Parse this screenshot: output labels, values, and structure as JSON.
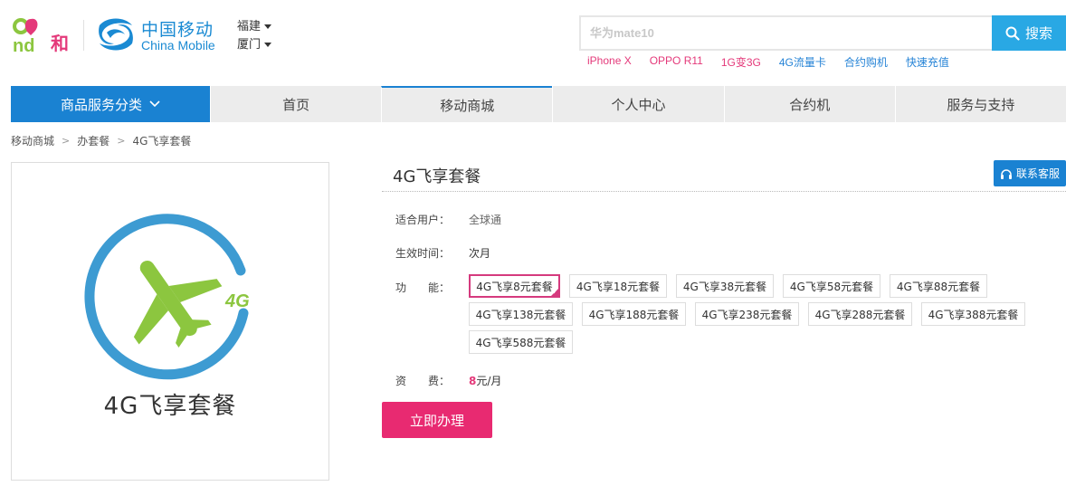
{
  "brand": {
    "and_logo": "and和",
    "cm_cn": "中国移动",
    "cm_en": "China Mobile"
  },
  "region": {
    "province": "福建",
    "city": "厦门"
  },
  "search": {
    "placeholder": "华为mate10",
    "button_label": "搜索",
    "hot_words": [
      "iPhone X",
      "OPPO R11",
      "1G变3G",
      "4G流量卡",
      "合约购机",
      "快速充值"
    ]
  },
  "nav": {
    "category_label": "商品服务分类",
    "items": [
      "首页",
      "移动商城",
      "个人中心",
      "合约机",
      "服务与支持"
    ],
    "active_index": 1
  },
  "breadcrumb": [
    "移动商城",
    "办套餐",
    "4G飞享套餐"
  ],
  "product": {
    "image_caption": "4G飞享套餐",
    "image_badge": "4G",
    "title": "4G飞享套餐",
    "service_button": "联系客服",
    "rows": {
      "user_label": "适合用户：",
      "user_value": "全球通",
      "effect_label": "生效时间：",
      "effect_value": "次月",
      "func_label": "功　　能：",
      "fee_label": "资　　费：",
      "fee_amount": "8",
      "fee_unit": "元/月"
    },
    "options": [
      "4G飞享8元套餐",
      "4G飞享18元套餐",
      "4G飞享38元套餐",
      "4G飞享58元套餐",
      "4G飞享88元套餐",
      "4G飞享138元套餐",
      "4G飞享188元套餐",
      "4G飞享238元套餐",
      "4G飞享288元套餐",
      "4G飞享388元套餐",
      "4G飞享588元套餐"
    ],
    "selected_option": 0,
    "buy_button": "立即办理"
  },
  "colors": {
    "brand_blue": "#1a82d2",
    "search_blue": "#29a8e4",
    "accent_pink": "#e82a71",
    "select_pink": "#d53a7e",
    "plane_green": "#8cc63f",
    "ring_blue": "#3d9bd2"
  }
}
